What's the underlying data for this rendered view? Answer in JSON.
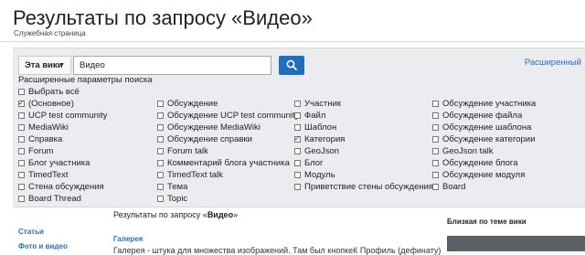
{
  "page": {
    "title": "Результаты по запросу «Видео»",
    "subtitle": "Служебная страница"
  },
  "search": {
    "scope_label": "Эта вики",
    "query": "Видео",
    "advanced_link": "Расширенный"
  },
  "advanced": {
    "label": "Расширенные параметры поиска",
    "select_all": "Выбрать всё",
    "columns": [
      [
        {
          "label": "(Основное)",
          "checked": true
        },
        {
          "label": "UCP test community",
          "checked": false
        },
        {
          "label": "MediaWiki",
          "checked": false
        },
        {
          "label": "Справка",
          "checked": false
        },
        {
          "label": "Forum",
          "checked": false
        },
        {
          "label": "Блог участника",
          "checked": false
        },
        {
          "label": "TimedText",
          "checked": false
        },
        {
          "label": "Стена обсуждения",
          "checked": false
        },
        {
          "label": "Board Thread",
          "checked": false
        }
      ],
      [
        {
          "label": "Обсуждение",
          "checked": false
        },
        {
          "label": "Обсуждение UCP test community",
          "checked": false
        },
        {
          "label": "Обсуждение MediaWiki",
          "checked": false
        },
        {
          "label": "Обсуждение справки",
          "checked": false
        },
        {
          "label": "Forum talk",
          "checked": false
        },
        {
          "label": "Комментарий блога участника",
          "checked": false
        },
        {
          "label": "TimedText talk",
          "checked": false
        },
        {
          "label": "Тема",
          "checked": false
        },
        {
          "label": "Topic",
          "checked": false
        }
      ],
      [
        {
          "label": "Участник",
          "checked": false
        },
        {
          "label": "Файл",
          "checked": false
        },
        {
          "label": "Шаблон",
          "checked": false
        },
        {
          "label": "Категория",
          "checked": true
        },
        {
          "label": "GeoJson",
          "checked": false
        },
        {
          "label": "Блог",
          "checked": false
        },
        {
          "label": "Модуль",
          "checked": false
        },
        {
          "label": "Приветствие стены обсуждения",
          "checked": false
        }
      ],
      [
        {
          "label": "Обсуждение участника",
          "checked": false
        },
        {
          "label": "Обсуждение файла",
          "checked": false
        },
        {
          "label": "Обсуждение шаблона",
          "checked": false
        },
        {
          "label": "Обсуждение категории",
          "checked": false
        },
        {
          "label": "GeoJson talk",
          "checked": false
        },
        {
          "label": "Обсуждение блога",
          "checked": false
        },
        {
          "label": "Обсуждение модуля",
          "checked": false
        },
        {
          "label": "Board",
          "checked": false
        }
      ]
    ]
  },
  "results": {
    "header_prefix": "Результаты по запросу «",
    "header_query": "Видео",
    "header_suffix": "»",
    "left_links": [
      "Статьи",
      "Фото и видео"
    ],
    "gallery_title": "Галерея",
    "snippet": "Галерея - штука для множества изображений. Там был кнопкеК Профиль (дефинату)"
  },
  "sidebar": {
    "wiki_heading": "Близкая по теме вики"
  },
  "colors": {
    "accent": "#1f6fbd",
    "link": "#2a6fb8",
    "panel_bg": "#eaecf0"
  }
}
